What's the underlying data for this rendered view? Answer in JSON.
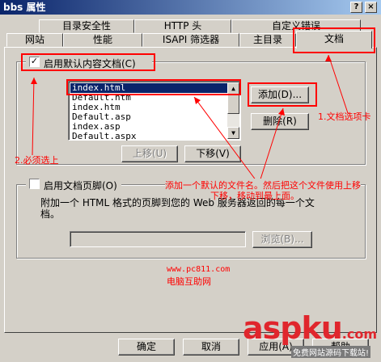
{
  "window": {
    "title": "bbs 属性",
    "help_btn": "?",
    "close_btn": "×"
  },
  "tabs": {
    "row_back": [
      "目录安全性",
      "HTTP 头",
      "自定义错误"
    ],
    "row_front": [
      "网站",
      "性能",
      "ISAPI 筛选器",
      "主目录",
      "文档"
    ],
    "active": "文档"
  },
  "default_doc": {
    "checkbox_label": "启用默认内容文档(C)",
    "checked": true,
    "check_mark": "✓",
    "list_items": [
      "index.html",
      "Default.htm",
      "index.htm",
      "Default.asp",
      "index.asp",
      "Default.aspx"
    ],
    "selected_index": 0,
    "add_btn": "添加(D)...",
    "remove_btn": "删除(R)",
    "move_up_btn": "上移(U)",
    "move_down_btn": "下移(V)"
  },
  "footer_doc": {
    "checkbox_label": "启用文档页脚(O)",
    "checked": false,
    "description": "附加一个 HTML 格式的页脚到您的 Web 服务器返回的每一个文档。",
    "path_value": "",
    "browse_btn": "浏览(B)..."
  },
  "dialog_buttons": {
    "ok": "确定",
    "cancel": "取消",
    "apply": "应用(A)",
    "help": "帮助"
  },
  "annotations": {
    "tab_note": "1.文档选项卡",
    "check_note": "2.必须选上",
    "add_note_line1": "添加一个默认的文件名。然后把这个文件使用上移",
    "add_note_line2": "下移，移动到最上面。",
    "site_url": "www.pc811.com",
    "site_name": "电脑互助网",
    "accent_color": "#ff0000"
  },
  "watermark": {
    "brand": "aspku",
    "tld": ".com",
    "tagline": "免费网站源码下载站!",
    "brand_color": "#e0262d"
  }
}
